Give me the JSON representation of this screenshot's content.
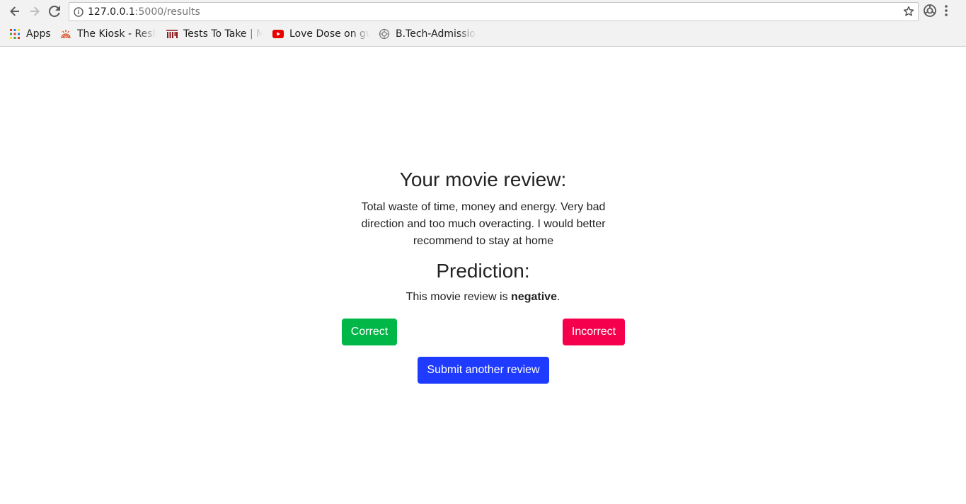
{
  "browser": {
    "url_host": "127.0.0.1",
    "url_path": ":5000/results",
    "bookmarks": [
      {
        "label": "Apps",
        "icon": "apps-grid-icon"
      },
      {
        "label": "The Kiosk - Resid",
        "icon": "kiosk-fingerprint-icon"
      },
      {
        "label": "Tests To Take | M",
        "icon": "mit-icon"
      },
      {
        "label": "Love Dose on gu",
        "icon": "youtube-icon"
      },
      {
        "label": "B.Tech-Admissio",
        "icon": "university-seal-icon"
      }
    ]
  },
  "page": {
    "review_heading": "Your movie review:",
    "review_text": "Total waste of time, money and energy. Very bad direction and too much overacting. I would better recommend to stay at home",
    "prediction_heading": "Prediction:",
    "prediction_prefix": "This movie review is ",
    "prediction_label": "negative",
    "prediction_suffix": ".",
    "correct_label": "Correct",
    "incorrect_label": "Incorrect",
    "submit_label": "Submit another review"
  },
  "colors": {
    "correct": "#00b748",
    "incorrect": "#f5004d",
    "submit": "#1f3bff"
  }
}
